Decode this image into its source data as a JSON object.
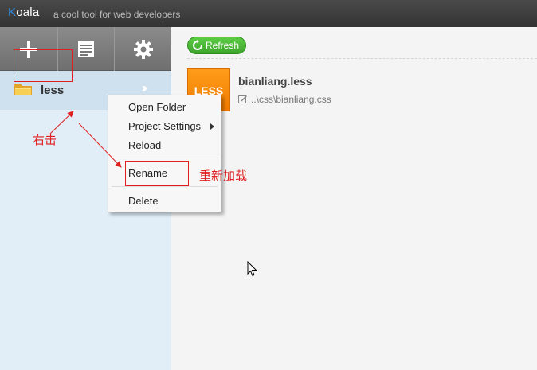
{
  "titlebar": {
    "app_name_first": "K",
    "app_name_rest": "oala",
    "tagline": "a cool tool for web developers"
  },
  "toolbar": {
    "buttons": [
      {
        "name": "add-project",
        "icon": "plus-icon"
      },
      {
        "name": "compile",
        "icon": "document-icon"
      },
      {
        "name": "settings",
        "icon": "gear-icon"
      }
    ]
  },
  "sidebar": {
    "project": {
      "name": "less",
      "icon": "folder-icon",
      "expand_label": "››"
    }
  },
  "main": {
    "refresh_label": "Refresh",
    "file": {
      "badge": "LESS",
      "name": "bianliang.less",
      "output": "..\\css\\bianliang.css"
    }
  },
  "context_menu": {
    "items": [
      {
        "label": "Open Folder"
      },
      {
        "label": "Project Settings",
        "has_submenu": true
      },
      {
        "label": "Reload"
      },
      {
        "label": "Rename"
      },
      {
        "label": "Delete"
      }
    ]
  },
  "annotations": {
    "right_click": "右击",
    "reload": "重新加载"
  },
  "colors": {
    "accent": "#2d8ce6",
    "annotation": "#e02020",
    "less_badge": "#f58a07",
    "refresh": "#4cb737"
  }
}
